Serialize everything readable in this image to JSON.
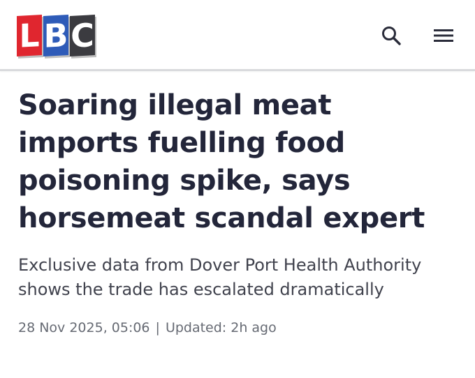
{
  "header": {
    "logo": {
      "letters": [
        "L",
        "B",
        "C"
      ],
      "colors": [
        "#e0262f",
        "#2e5bb8",
        "#3b3b40"
      ]
    },
    "search_icon": "search-icon",
    "menu_icon": "hamburger-menu-icon"
  },
  "article": {
    "headline": "Soaring illegal meat imports fuelling food poisoning spike, says horsemeat scandal expert",
    "standfirst": "Exclusive data from Dover Port Health Authority shows the trade has escalated dramatically",
    "published": "28 Nov 2025, 05:06",
    "separator": "|",
    "updated": "Updated: 2h ago"
  }
}
